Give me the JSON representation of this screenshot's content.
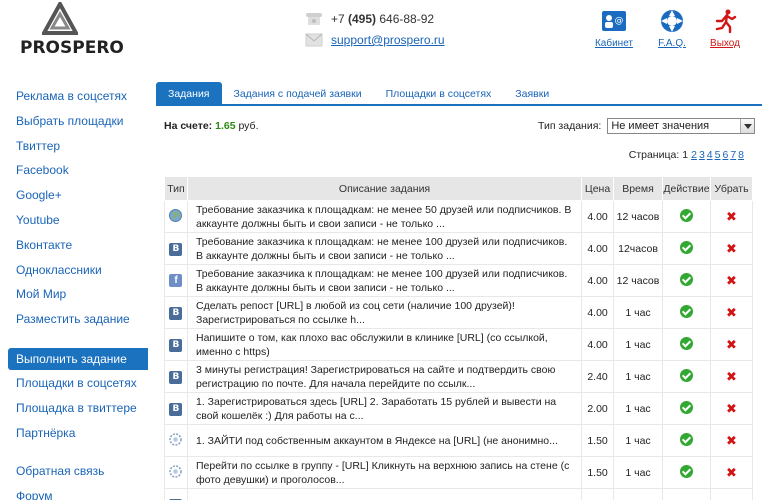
{
  "header": {
    "logo_text": "PROSPERO",
    "phone_prefix": "+7 ",
    "phone_code": "(495)",
    "phone_number": " 646-88-92",
    "email": "support@prospero.ru",
    "links": {
      "cabinet": "Кабинет",
      "faq": "F.A.Q.",
      "exit": "Выход"
    }
  },
  "sidebar": {
    "group1": [
      "Реклама в соцсетях",
      "Выбрать площадки",
      "Твиттер",
      "Facebook",
      "Google+",
      "Youtube",
      "Вконтакте",
      "Одноклассники",
      "Мой Мир",
      "Разместить задание"
    ],
    "active": "Выполнить задание",
    "group2": [
      "Площадки в соцсетях",
      "Площадка в твиттере",
      "Партнёрка"
    ],
    "group3": [
      "Обратная связь",
      "Форум"
    ]
  },
  "tabs": [
    "Задания",
    "Задания с подачей заявки",
    "Площадки в соцсетях",
    "Заявки"
  ],
  "balance": {
    "label": "На счете:",
    "amount": "1.65",
    "currency": " руб."
  },
  "filter": {
    "label": "Тип задания:",
    "value": "Не имеет значения"
  },
  "pager": {
    "label": "Страница:",
    "current": "1",
    "pages": [
      "2",
      "3",
      "4",
      "5",
      "6",
      "7",
      "8"
    ]
  },
  "table": {
    "headers": {
      "type": "Тип",
      "desc": "Описание задания",
      "price": "Цена",
      "time": "Время",
      "action": "Действие",
      "remove": "Убрать"
    },
    "rows": [
      {
        "icon": "globe",
        "desc": "Требование заказчика к площадкам: не менее 50 друзей или подписчиков. В аккаунте должны быть и свои записи - не только ...",
        "price": "4.00",
        "time": "12 часов"
      },
      {
        "icon": "vk",
        "desc": "Требование заказчика к площадкам: не менее 100 друзей или подписчиков. В аккаунте должны быть и свои записи - не только ...",
        "price": "4.00",
        "time": "12часов"
      },
      {
        "icon": "fb",
        "desc": "Требование заказчика к площадкам: не менее 100 друзей или подписчиков. В аккаунте должны быть и свои записи - не только ...",
        "price": "4.00",
        "time": "12 часов"
      },
      {
        "icon": "vk",
        "desc": "Сделать репост [URL] в любой из соц сети (наличие 100 друзей)! Зарегистрироваться по ссылке h...",
        "price": "4.00",
        "time": "1 час"
      },
      {
        "icon": "vk",
        "desc": "Напишите о том, как плохо вас обслужили в клинике [URL] (со ссылкой, именно с https)",
        "price": "4.00",
        "time": "1 час"
      },
      {
        "icon": "vk",
        "desc": "3 минуты регистрация! Зарегистрироваться на сайте и подтвердить свою регистрацию по почте. Для начала перейдите по ссылк...",
        "price": "2.40",
        "time": "1 час"
      },
      {
        "icon": "vk",
        "desc": "1. Зарегистрироваться здесь [URL] 2. Заработать 15 рублей и вывести на свой кошелёк :) Для работы на с...",
        "price": "2.00",
        "time": "1 час"
      },
      {
        "icon": "gear",
        "desc": "1. ЗАЙТИ под собственным аккаунтом в Яндексе на [URL] (не анонимно...",
        "price": "1.50",
        "time": "1 час"
      },
      {
        "icon": "gear",
        "desc": "Перейти по ссылке в группу - [URL] Кликнуть на верхнюю запись на стене (с фото девушки) и проголосов...",
        "price": "1.50",
        "time": "1 час"
      },
      {
        "icon": "vk",
        "desc": "",
        "price": "",
        "time": ""
      }
    ]
  },
  "colors": {
    "accent": "#1b72bf",
    "link": "#1a64b8",
    "ok": "#32a832",
    "remove": "#d21414"
  }
}
